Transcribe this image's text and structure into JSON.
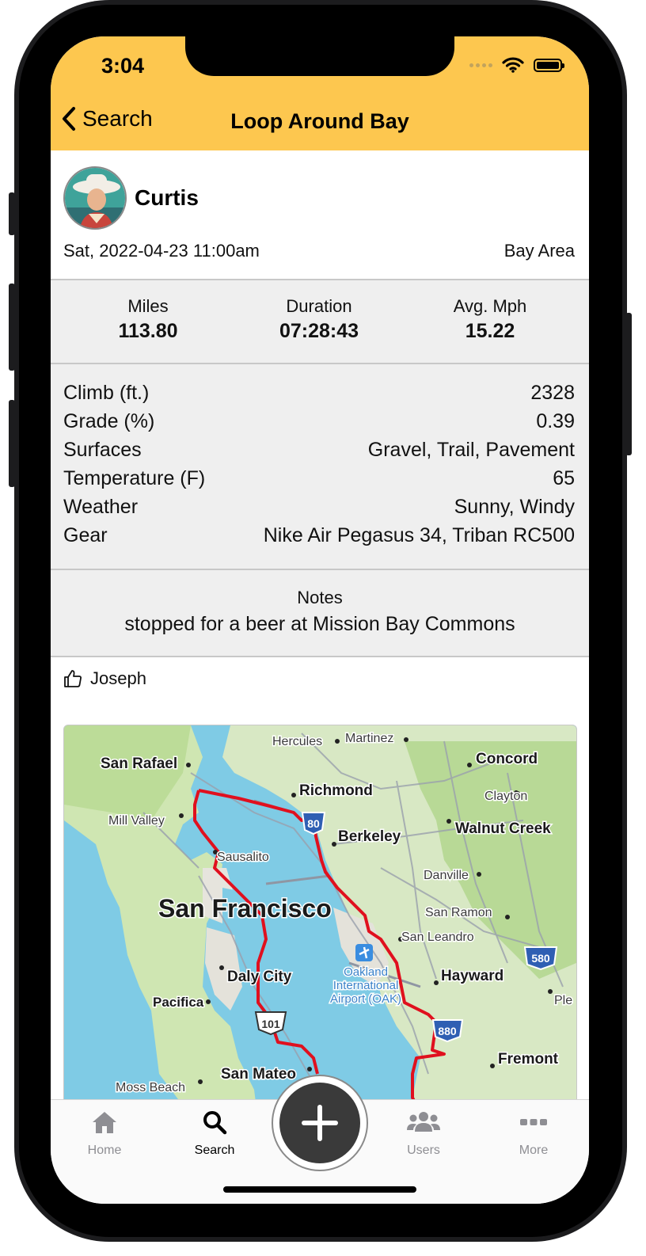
{
  "status_bar": {
    "time": "3:04"
  },
  "nav": {
    "back_label": "Search",
    "title": "Loop Around Bay"
  },
  "activity": {
    "user_name": "Curtis",
    "date": "Sat, 2022-04-23 11:00am",
    "area": "Bay Area"
  },
  "stats": [
    {
      "label": "Miles",
      "value": "113.80"
    },
    {
      "label": "Duration",
      "value": "07:28:43"
    },
    {
      "label": "Avg. Mph",
      "value": "15.22"
    }
  ],
  "details": [
    {
      "label": "Climb (ft.)",
      "value": "2328"
    },
    {
      "label": "Grade (%)",
      "value": "0.39"
    },
    {
      "label": "Surfaces",
      "value": "Gravel, Trail, Pavement"
    },
    {
      "label": "Temperature (F)",
      "value": "65"
    },
    {
      "label": "Weather",
      "value": "Sunny, Windy"
    },
    {
      "label": "Gear",
      "value": "Nike Air Pegasus 34, Triban RC500"
    }
  ],
  "notes": {
    "label": "Notes",
    "text": "stopped for a beer at Mission Bay Commons"
  },
  "likes": {
    "names": "Joseph"
  },
  "map": {
    "labels": {
      "hercules": "Hercules",
      "martinez": "Martinez",
      "concord": "Concord",
      "san_rafael": "San Rafael",
      "richmond": "Richmond",
      "clayton": "Clayton",
      "mill_valley": "Mill Valley",
      "berkeley": "Berkeley",
      "walnut_creek": "Walnut Creek",
      "sausalito": "Sausalito",
      "danville": "Danville",
      "san_francisco": "San Francisco",
      "san_ramon": "San Ramon",
      "san_leandro": "San Leandro",
      "oakland_airport_1": "Oakland",
      "oakland_airport_2": "International",
      "oakland_airport_3": "Airport (OAK)",
      "daly_city": "Daly City",
      "hayward": "Hayward",
      "pacifica": "Pacifica",
      "fremont": "Fremont",
      "san_mateo": "San Mateo",
      "moss_beach": "Moss Beach",
      "pleasanton": "Ple",
      "shield_80": "80",
      "shield_580": "580",
      "shield_880": "880",
      "shield_101": "101"
    },
    "route_color": "#e0101e"
  },
  "tabs": [
    {
      "label": "Home",
      "icon": "home-icon",
      "active": false
    },
    {
      "label": "Search",
      "icon": "search-icon",
      "active": true
    },
    {
      "label": "Users",
      "icon": "users-icon",
      "active": false
    },
    {
      "label": "More",
      "icon": "more-icon",
      "active": false
    }
  ],
  "colors": {
    "header": "#fdc74f",
    "active_tab": "#000000",
    "inactive_tab": "#8e8e93"
  }
}
